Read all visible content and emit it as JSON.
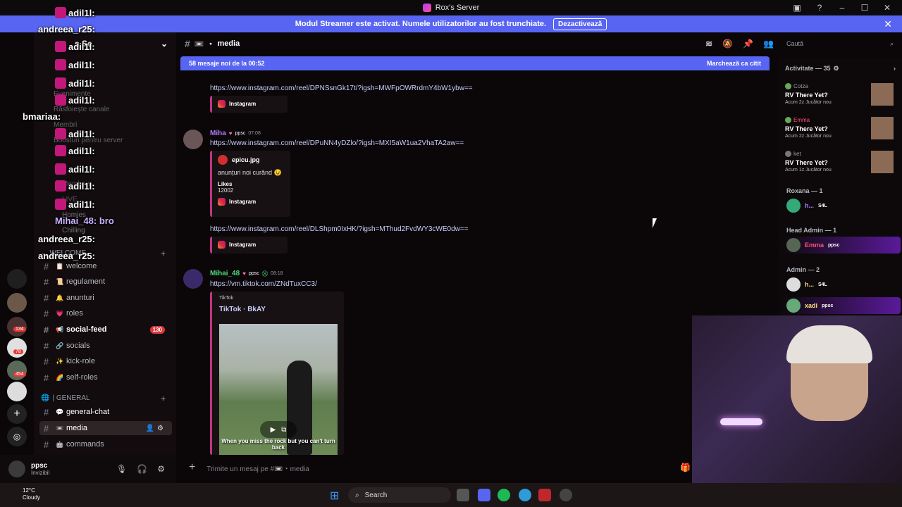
{
  "titlebar": {
    "title": "Rox's Server"
  },
  "banner": {
    "text": "Modul Streamer este activat. Numele utilizatorilor au fost trunchiate.",
    "button": "Dezactivează"
  },
  "guild_badges": [
    "130",
    "134",
    "78",
    "454"
  ],
  "overlay_chat": [
    {
      "name": "adil1l:",
      "color": "plain"
    },
    {
      "name": "andreea_r25:",
      "color": "plain"
    },
    {
      "name": "adil1l:",
      "color": "plain"
    },
    {
      "name": "adil1l:",
      "color": "plain"
    },
    {
      "name": "adil1l:",
      "color": "plain"
    },
    {
      "name": "adil1l:",
      "color": "plain"
    },
    {
      "name": "bmariaa:",
      "color": "plain"
    },
    {
      "name": "adil1l:",
      "color": "plain"
    },
    {
      "name": "adil1l:",
      "color": "plain"
    },
    {
      "name": "adil1l:",
      "color": "plain"
    },
    {
      "name": "adil1l:",
      "color": "plain"
    },
    {
      "name": "adil1l:",
      "color": "plain"
    },
    {
      "name": "Mihai_48: bro",
      "color": "purple"
    },
    {
      "name": "andreea_r25:",
      "color": "plain"
    },
    {
      "name": "andreea_r25:",
      "color": "plain"
    }
  ],
  "sidebar": {
    "server_name": "s Se",
    "ghost_items": [
      "Evenimente",
      "Răsfoiește canale",
      "Membri",
      "Boosturi pentru server",
      "Members",
      "LIVE",
      "Homies",
      "Chilling"
    ],
    "welcome_category": "WELCOME",
    "welcome_channels": [
      {
        "name": "welcome",
        "icon": "📋"
      },
      {
        "name": "regulament",
        "icon": "📜"
      },
      {
        "name": "anunturi",
        "icon": "🔔"
      },
      {
        "name": "roles",
        "icon": "💗"
      },
      {
        "name": "social-feed",
        "icon": "📢",
        "badge": "130"
      },
      {
        "name": "socials",
        "icon": "🔗"
      },
      {
        "name": "kick-role",
        "icon": "✨"
      },
      {
        "name": "self-roles",
        "icon": "🌈"
      }
    ],
    "general_category": "| GENERAL",
    "general_channels": [
      {
        "name": "general-chat",
        "icon": "💬"
      },
      {
        "name": "media",
        "icon": "📼",
        "active": true
      },
      {
        "name": "commands",
        "icon": "🤖"
      }
    ]
  },
  "user": {
    "name": "ppsc",
    "status": "Invizibil"
  },
  "chat": {
    "channel": "media",
    "channel_icon": "📼",
    "new_messages": "58 mesaje noi de la 00:52",
    "mark_read": "Marchează ca citit",
    "link1": "https://www.instagram.com/reel/DPNSsnGk17t/?igsh=MWFpOWRrdmY4bW1ybw==",
    "embed_provider": "Instagram",
    "msg1": {
      "author": "Miha",
      "tag": "ppsc",
      "time": "07:08",
      "link": "https://www.instagram.com/reel/DPuNN4yDZlo/?igsh=MXI5aW1ua2VhaTA2aw==",
      "embed_title": "epicu.jpg",
      "embed_text": "anunțuri noi curând 😉",
      "embed_likes_label": "Likes",
      "embed_likes": "12002",
      "link2": "https://www.instagram.com/reel/DLShpm0IxHK/?igsh=MThud2FvdWY3cWE0dw=="
    },
    "msg2": {
      "author": "Mihai_48",
      "tag": "ppsc",
      "time": "08:18",
      "link": "https://vm.tiktok.com/ZNdTuxCC3/",
      "provider": "TikTok",
      "title": "TikTok · BkAY",
      "caption": "When you miss the rock but you can't turn back"
    },
    "composer_placeholder": "Trimite un mesaj pe #📼・media"
  },
  "search": {
    "placeholder": "Caută"
  },
  "activity": {
    "header": "Activitate — 35",
    "items": [
      {
        "name": "Cotza",
        "game": "RV There Yet?",
        "sub": "Acum 2z  Jucător nou"
      },
      {
        "name": "Emma",
        "game": "RV There Yet?",
        "sub": "Acum 2z  Jucător nou"
      },
      {
        "name": "ket",
        "game": "RV There Yet?",
        "sub": "Acum 1z  Jucător nou"
      }
    ]
  },
  "roles": [
    {
      "header": "Roxana — 1",
      "members": [
        {
          "name": "h...",
          "tag": "S4L",
          "color": "#b07cff"
        }
      ]
    },
    {
      "header": "Head Admin — 1",
      "members": [
        {
          "name": "Emma",
          "tag": "ppsc",
          "color": "#ff4f7a",
          "highlight": true
        }
      ]
    },
    {
      "header": "Admin — 2",
      "members": [
        {
          "name": "h...",
          "tag": "S4L",
          "color": "#ffd27a"
        },
        {
          "name": "xadi",
          "tag": "ppsc",
          "color": "#ffe37a",
          "highlight": true
        }
      ]
    }
  ],
  "taskbar": {
    "temp": "12°C",
    "weather": "Cloudy",
    "search": "Search"
  },
  "colors": {
    "accent": "#5865f2",
    "instagram": "#c13584",
    "badge": "#da373c"
  }
}
